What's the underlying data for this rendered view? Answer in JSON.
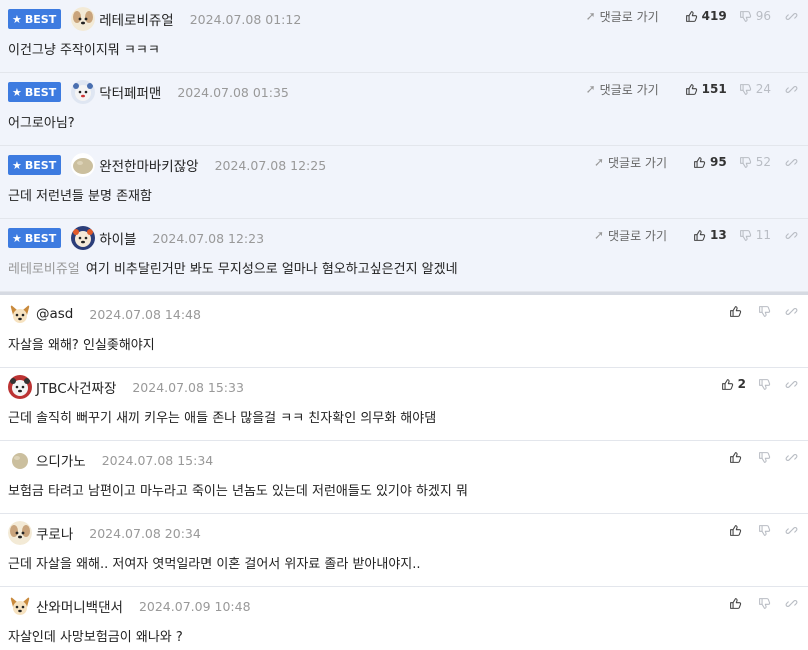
{
  "labels": {
    "best_badge": "BEST",
    "reply_link": "댓글로 가기"
  },
  "best_comments": [
    {
      "nickname": "레테로비쥬얼",
      "avatar": "puppy-avatar",
      "date": "2024.07.08 01:12",
      "text": "이건그냥 주작이지뭐 ㅋㅋㅋ",
      "mention": "",
      "likes": "419",
      "dislikes": "96"
    },
    {
      "nickname": "닥터페퍼맨",
      "avatar": "bear-avatar",
      "date": "2024.07.08 01:35",
      "text": "어그로아님?",
      "mention": "",
      "likes": "151",
      "dislikes": "24"
    },
    {
      "nickname": "완전한마바키잖앙",
      "avatar": "stone-avatar",
      "date": "2024.07.08 12:25",
      "text": "근데 저런년들 분명 존재함",
      "mention": "",
      "likes": "95",
      "dislikes": "52"
    },
    {
      "nickname": "하이블",
      "avatar": "bear-avatar",
      "date": "2024.07.08 12:23",
      "text": "여기 비추달린거만 봐도 무지성으로 얼마나 혐오하고싶은건지 알겠네",
      "mention": "레테로비쥬얼",
      "likes": "13",
      "dislikes": "11"
    }
  ],
  "comments": [
    {
      "nickname": "@asd",
      "avatar": "dog-avatar",
      "date": "2024.07.08 14:48",
      "text": "자살을 왜해? 인실좆해야지",
      "likes": ""
    },
    {
      "nickname": "JTBC사건짜장",
      "avatar": "bear-avatar",
      "date": "2024.07.08 15:33",
      "text": "근데 솔직히 뻐꾸기 새끼 키우는 애들 존나 많을걸 ㅋㅋ 친자확인 의무화 해야댐",
      "likes": "2"
    },
    {
      "nickname": "으디가노",
      "avatar": "stone-avatar",
      "date": "2024.07.08 15:34",
      "text": "보험금 타려고 남편이고 마누라고 죽이는 년놈도 있는데 저런애들도 있기야 하겠지 뭐",
      "likes": ""
    },
    {
      "nickname": "쿠로나",
      "avatar": "puppy-avatar",
      "date": "2024.07.08 20:34",
      "text": "근데 자살을 왜해.. 저여자 엿먹일라면 이혼 걸어서 위자료 졸라 받아내야지..",
      "likes": ""
    },
    {
      "nickname": "산와머니백댄서",
      "avatar": "dog-avatar",
      "date": "2024.07.09 10:48",
      "text": "자살인데 사망보험금이 왜나와 ?",
      "likes": ""
    }
  ],
  "colors": {
    "best_badge": "#3d7be0",
    "best_row_bg": "#f1f4fb",
    "date_text": "#999999",
    "dislike_text": "#b9bdc4"
  }
}
